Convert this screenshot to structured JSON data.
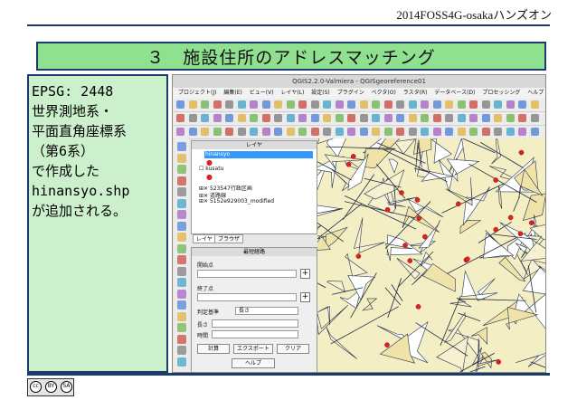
{
  "header": {
    "text": "2014FOSS4G-osakaハンズオン"
  },
  "title": {
    "text": "３　施設住所のアドレスマッチング"
  },
  "left_panel": {
    "lines": [
      "EPSG: 2448",
      "世界測地系・",
      "平面直角座標系",
      "（第6系）",
      "で作成した",
      "hinansyo.shp",
      "が追加される。"
    ]
  },
  "qgis": {
    "window_title": "QGIS2.2.0-Valmiera - QGISgeoreference01",
    "menu": [
      "プロジェクト(J)",
      "編集(E)",
      "ビュー(V)",
      "レイヤ(L)",
      "設定(S)",
      "プラグイン",
      "ベクタ(O)",
      "ラスタ(R)",
      "データベース(D)",
      "プロセッシング",
      "ヘルプ"
    ],
    "layers_panel": {
      "title": "レイヤ",
      "items": [
        "hinansyo",
        "kusatu",
        "523547行政区画",
        "道路線",
        "5152e929003_modified"
      ]
    },
    "tabs": [
      "レイヤ",
      "ブラウザ"
    ],
    "route_panel": {
      "title": "最短経路",
      "start_label": "開始点",
      "end_label": "終了点",
      "criterion_label": "判定基準",
      "criterion_value": "長さ",
      "length_label": "長さ",
      "time_label": "時間",
      "calculate_button": "計算",
      "export_button": "エクスポート",
      "clear_button": "クリア",
      "help_button": "ヘルプ"
    }
  },
  "license": {
    "cc": "cc",
    "by": "BY",
    "sa": "SA"
  },
  "colors": {
    "rule": "#1b3b6f",
    "title_bg": "#8fe08f",
    "panel_bg": "#ccf0cc",
    "map_bg": "#f4eec4",
    "point": "#e02020"
  }
}
